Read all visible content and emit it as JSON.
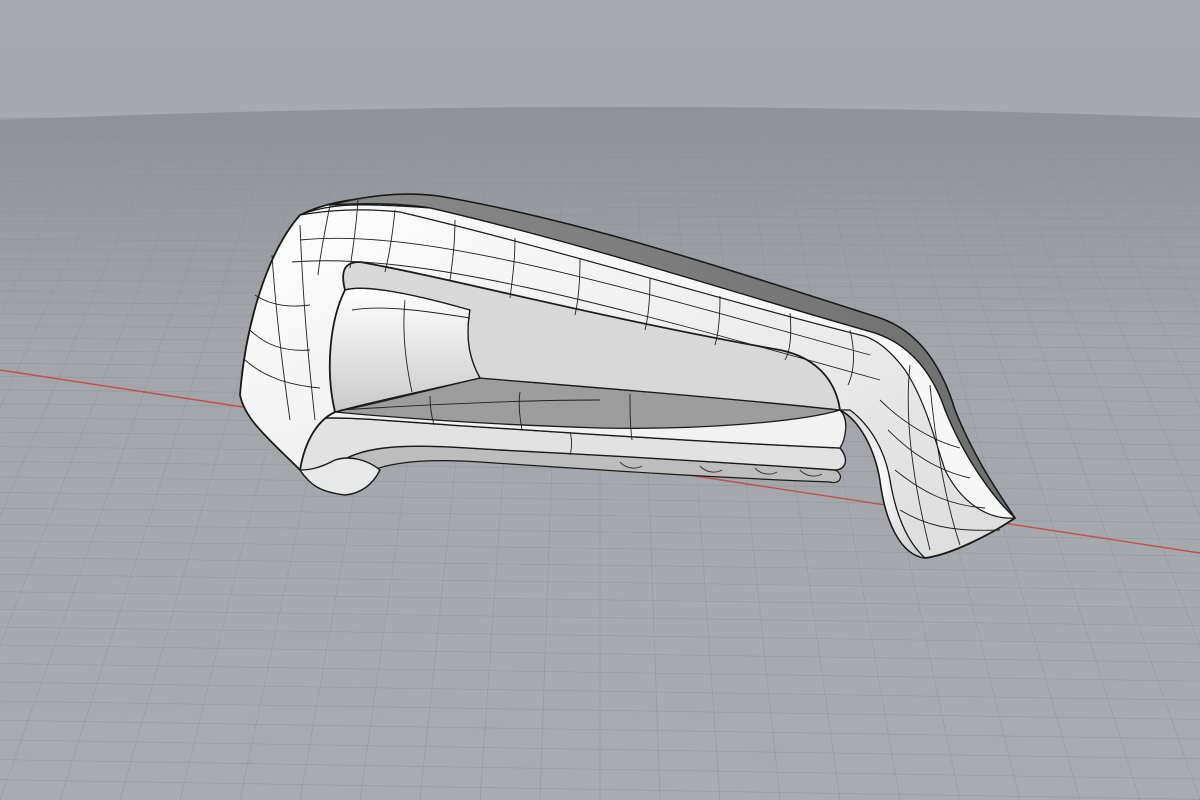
{
  "viewport": {
    "view": "perspective",
    "background_color": "#a3a6ab",
    "construction_plane": {
      "grid": true,
      "grid_color": "#8e9196",
      "x_axis_color": "#c0504a"
    },
    "model": {
      "display_mode": "shaded",
      "surface_color": "#ececec",
      "edge_color": "#1a1a1a"
    }
  }
}
